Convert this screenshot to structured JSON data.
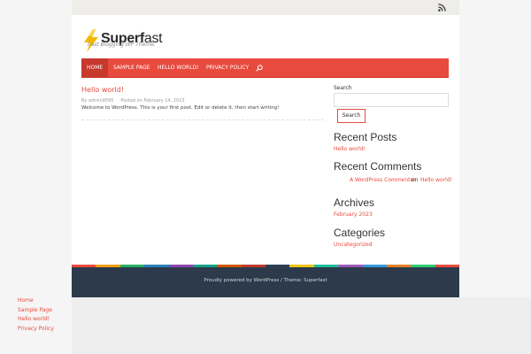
{
  "site": {
    "brand_part1": "Superf",
    "brand_part2": "ast",
    "tagline": "Fast Blogging WP Theme.",
    "rss_icon": "rss-icon",
    "logo_icon": "lightning-bolt-icon"
  },
  "nav": {
    "items": [
      {
        "label": "Home",
        "active": true
      },
      {
        "label": "Sample Page",
        "active": false
      },
      {
        "label": "Hello world!",
        "active": false
      },
      {
        "label": "Privacy Policy",
        "active": false
      }
    ],
    "search_icon": "search-icon"
  },
  "post": {
    "title": "Hello world!",
    "meta_author": "By admin9595",
    "meta_date": "Posted on February 14, 2023",
    "body": "Welcome to WordPress. This is your first post. Edit or delete it, then start writing!"
  },
  "sidebar": {
    "search_label": "Search",
    "search_value": "",
    "search_button": "Search",
    "recent_posts": {
      "title": "Recent Posts",
      "items": [
        "Hello world!"
      ]
    },
    "recent_comments": {
      "title": "Recent Comments",
      "author": "A WordPress Commenter",
      "on": "on",
      "post": "Hello world!"
    },
    "archives": {
      "title": "Archives",
      "items": [
        "February 2023"
      ]
    },
    "categories": {
      "title": "Categories",
      "items": [
        "Uncategorized"
      ]
    }
  },
  "footer": {
    "text": "Proudly powered by WordPress / Theme: Superfast"
  },
  "bottom_links": [
    "Home",
    "Sample Page",
    "Hello world!",
    "Privacy Policy"
  ],
  "colors": {
    "accent": "#e94a3e",
    "nav_active": "#c7382d",
    "footer_bg": "#2c3a4b",
    "stripe": [
      "#e94a3e",
      "#f39c12",
      "#27ae60",
      "#2980b9",
      "#8e44ad",
      "#16a085",
      "#d35400",
      "#c0392b",
      "#2c3e50",
      "#f1c40f",
      "#1abc9c",
      "#9b59b6",
      "#3498db",
      "#e67e22",
      "#2ecc71",
      "#e74c3c"
    ]
  }
}
